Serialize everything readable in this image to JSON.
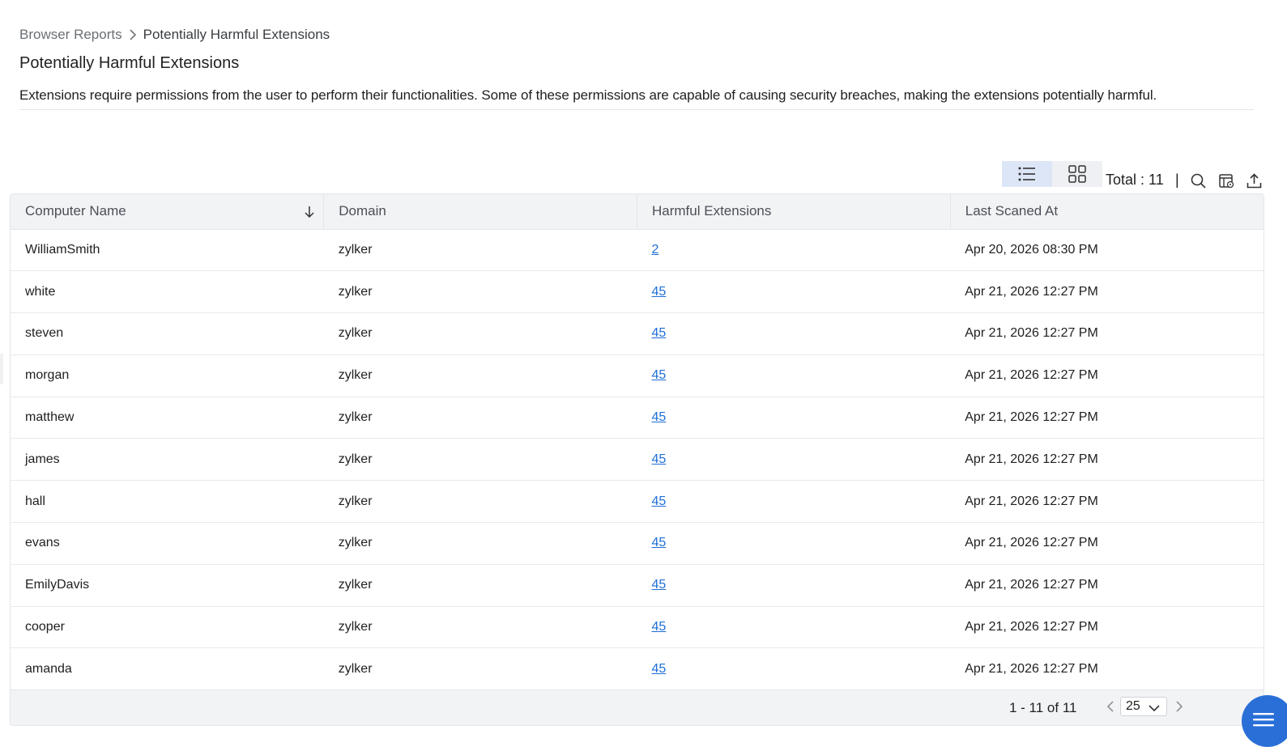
{
  "breadcrumb": {
    "parent": "Browser Reports",
    "current": "Potentially Harmful Extensions"
  },
  "page": {
    "title": "Potentially Harmful Extensions",
    "description": "Extensions require permissions from the user to perform their functionalities. Some of these permissions are capable of causing security breaches, making the extensions potentially harmful."
  },
  "toolbar": {
    "total_label": "Total : 11",
    "separator": "|",
    "view_modes": [
      "list-view-icon",
      "grid-view-icon"
    ],
    "active_view": "list",
    "icons": [
      "search-icon",
      "column-settings-icon",
      "export-icon"
    ]
  },
  "table": {
    "columns": [
      "Computer Name",
      "Domain",
      "Harmful Extensions",
      "Last Scaned At"
    ],
    "sort": {
      "column": "Computer Name",
      "direction": "descending"
    },
    "rows": [
      [
        "WilliamSmith",
        "zylker",
        "2",
        "Apr 20, 2026 08:30 PM"
      ],
      [
        "white",
        "zylker",
        "45",
        "Apr 21, 2026 12:27 PM"
      ],
      [
        "steven",
        "zylker",
        "45",
        "Apr 21, 2026 12:27 PM"
      ],
      [
        "morgan",
        "zylker",
        "45",
        "Apr 21, 2026 12:27 PM"
      ],
      [
        "matthew",
        "zylker",
        "45",
        "Apr 21, 2026 12:27 PM"
      ],
      [
        "james",
        "zylker",
        "45",
        "Apr 21, 2026 12:27 PM"
      ],
      [
        "hall",
        "zylker",
        "45",
        "Apr 21, 2026 12:27 PM"
      ],
      [
        "evans",
        "zylker",
        "45",
        "Apr 21, 2026 12:27 PM"
      ],
      [
        "EmilyDavis",
        "zylker",
        "45",
        "Apr 21, 2026 12:27 PM"
      ],
      [
        "cooper",
        "zylker",
        "45",
        "Apr 21, 2026 12:27 PM"
      ],
      [
        "amanda",
        "zylker",
        "45",
        "Apr 21, 2026 12:27 PM"
      ]
    ]
  },
  "pagination": {
    "range": "1 - 11 of 11",
    "page_size": "25"
  },
  "colors": {
    "link": "#1f6fd6",
    "header_bg": "#f2f3f5",
    "active_toggle": "#dde6f7",
    "fab": "#2a6fd8"
  }
}
